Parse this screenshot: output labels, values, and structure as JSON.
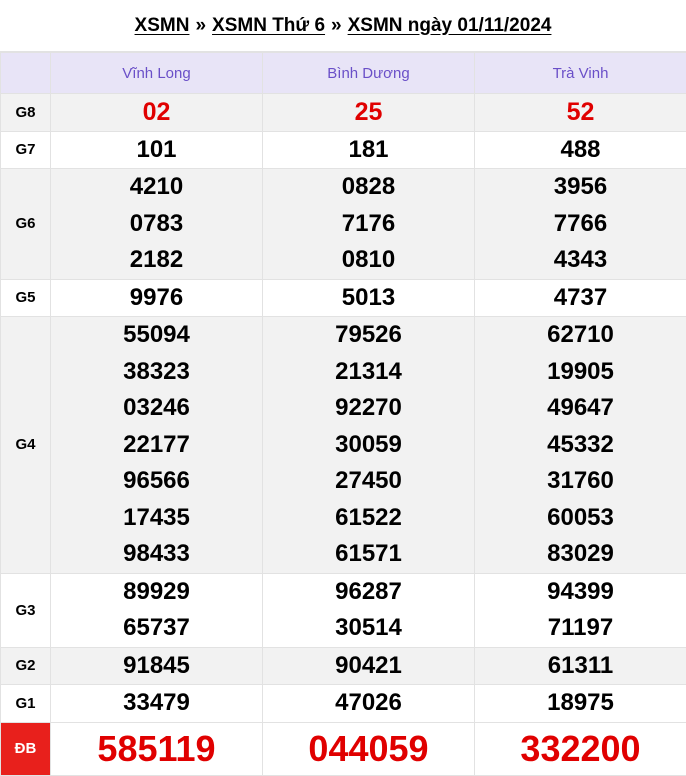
{
  "breadcrumb": {
    "item1": "XSMN",
    "item2": "XSMN Thứ 6",
    "item3": "XSMN ngày 01/11/2024",
    "separator": "»"
  },
  "provinces": [
    "Vĩnh Long",
    "Bình Dương",
    "Trà Vinh"
  ],
  "prizes": [
    {
      "label": "G8",
      "numbers": [
        [
          "02"
        ],
        [
          "25"
        ],
        [
          "52"
        ]
      ]
    },
    {
      "label": "G7",
      "numbers": [
        [
          "101"
        ],
        [
          "181"
        ],
        [
          "488"
        ]
      ]
    },
    {
      "label": "G6",
      "numbers": [
        [
          "4210",
          "0783",
          "2182"
        ],
        [
          "0828",
          "7176",
          "0810"
        ],
        [
          "3956",
          "7766",
          "4343"
        ]
      ]
    },
    {
      "label": "G5",
      "numbers": [
        [
          "9976"
        ],
        [
          "5013"
        ],
        [
          "4737"
        ]
      ]
    },
    {
      "label": "G4",
      "numbers": [
        [
          "55094",
          "38323",
          "03246",
          "22177",
          "96566",
          "17435",
          "98433"
        ],
        [
          "79526",
          "21314",
          "92270",
          "30059",
          "27450",
          "61522",
          "61571"
        ],
        [
          "62710",
          "19905",
          "49647",
          "45332",
          "31760",
          "60053",
          "83029"
        ]
      ]
    },
    {
      "label": "G3",
      "numbers": [
        [
          "89929",
          "65737"
        ],
        [
          "96287",
          "30514"
        ],
        [
          "94399",
          "71197"
        ]
      ]
    },
    {
      "label": "G2",
      "numbers": [
        [
          "91845"
        ],
        [
          "90421"
        ],
        [
          "61311"
        ]
      ]
    },
    {
      "label": "G1",
      "numbers": [
        [
          "33479"
        ],
        [
          "47026"
        ],
        [
          "18975"
        ]
      ]
    },
    {
      "label": "ĐB",
      "numbers": [
        [
          "585119"
        ],
        [
          "044059"
        ],
        [
          "332200"
        ]
      ]
    }
  ],
  "colors": {
    "accent_red": "#e00000",
    "header_purple": "#6a4fc8",
    "header_bg": "#e8e4f7"
  }
}
